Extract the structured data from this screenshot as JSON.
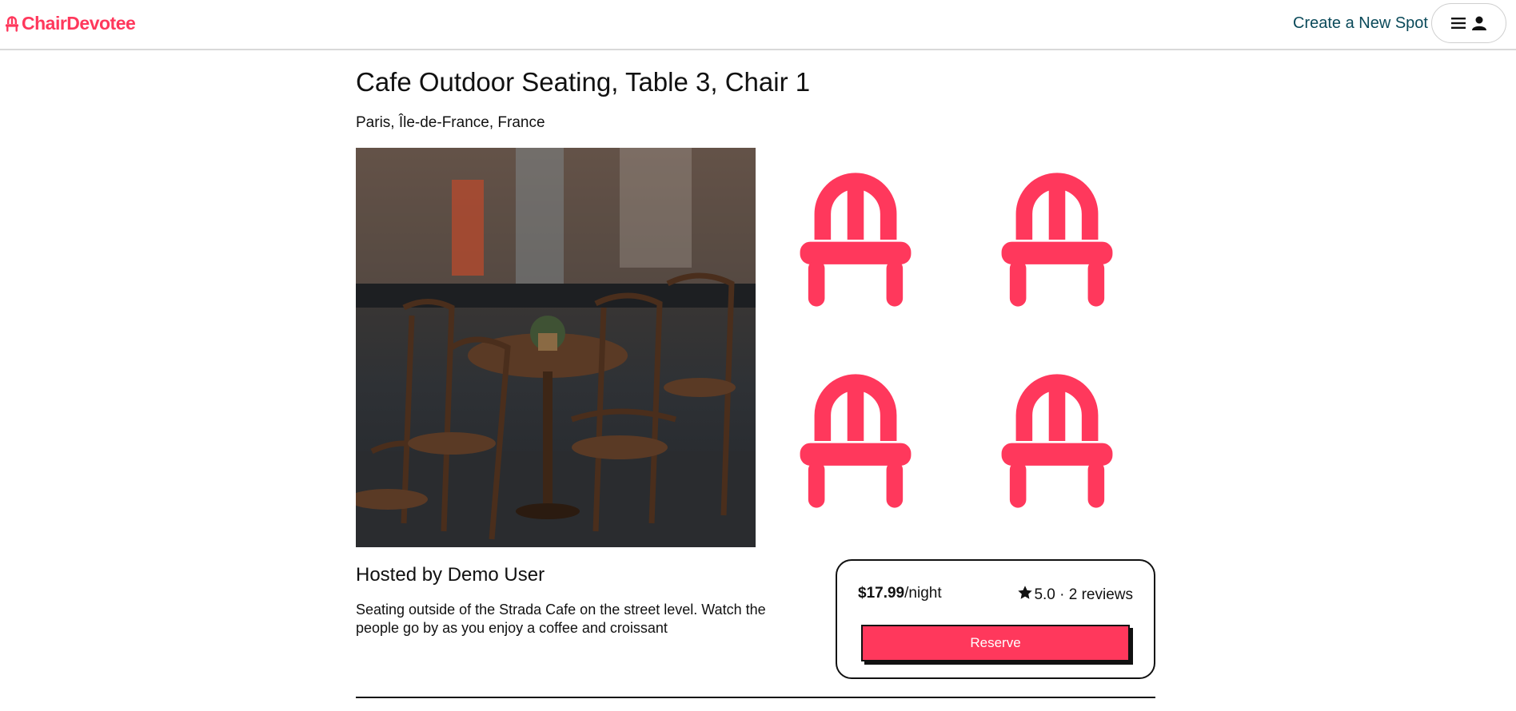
{
  "header": {
    "logo_text": "ChairDevotee",
    "logo_icon": "chair-icon",
    "create_spot_label": "Create a New Spot",
    "menu_icon": "hamburger-icon",
    "user_icon": "user-icon"
  },
  "spot": {
    "title": "Cafe Outdoor Seating, Table 3, Chair 1",
    "location": "Paris, Île-de-France, France",
    "hosted_by": "Hosted by Demo User",
    "description": "Seating outside of the Strada Cafe on the street level. Watch the people go by as you enjoy a coffee and croissant",
    "thumbnail_icon": "chair-icon",
    "thumbnail_count": 4
  },
  "booking": {
    "price": "$17.99",
    "price_unit": "/night",
    "star_icon": "star-icon",
    "rating": "5.0",
    "separator": " · ",
    "reviews": "2 reviews",
    "reserve_label": "Reserve"
  },
  "colors": {
    "brand": "#ff385c",
    "link": "#0b4a5a",
    "text": "#111111"
  }
}
